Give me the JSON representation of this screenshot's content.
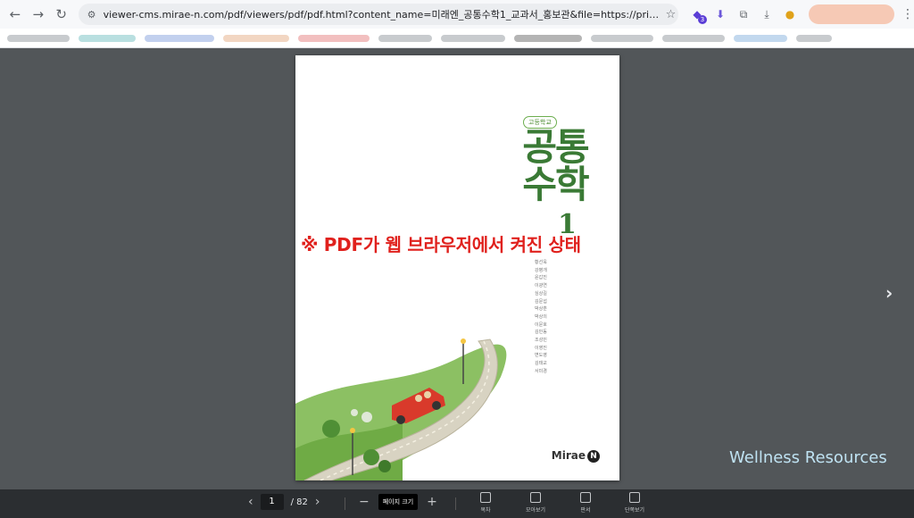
{
  "browser": {
    "url": "viewer-cms.mirae-n.com/pdf/viewers/pdf/pdf.html?content_name=미래엔_공통수학1_교과서_홍보관&file=https://privw-cms.mirae-n.com/documen...",
    "extension_badge": "3"
  },
  "book": {
    "grade_badge": "고등학교",
    "title_line1": "공통",
    "title_line2": "수학",
    "title_number": "1",
    "authors": [
      "황선욱",
      "강병개",
      "윤갑진",
      "이광연",
      "심상길",
      "김문섭",
      "박상훈",
      "박상의",
      "이문호",
      "김민동",
      "조성민",
      "이영진",
      "변도영",
      "김태교",
      "서미경"
    ],
    "publisher": "Mirae",
    "publisher_mark": "N"
  },
  "overlay_note": "※ PDF가 웹 브라우저에서 켜진 상태",
  "watermark": "Wellness Resources",
  "viewer": {
    "current_page": "1",
    "total_pages": "/ 82",
    "zoom_label": "페이지 크기",
    "tools": [
      {
        "label": "목차",
        "icon": "toc-icon"
      },
      {
        "label": "모아보기",
        "icon": "grid-icon"
      },
      {
        "label": "판서",
        "icon": "pen-icon"
      },
      {
        "label": "단쪽보기",
        "icon": "single-page-icon"
      }
    ]
  },
  "colors": {
    "viewer_bg": "#525659",
    "title_green": "#3a7a35",
    "note_red": "#e0211d",
    "car_red": "#d93a2b"
  }
}
